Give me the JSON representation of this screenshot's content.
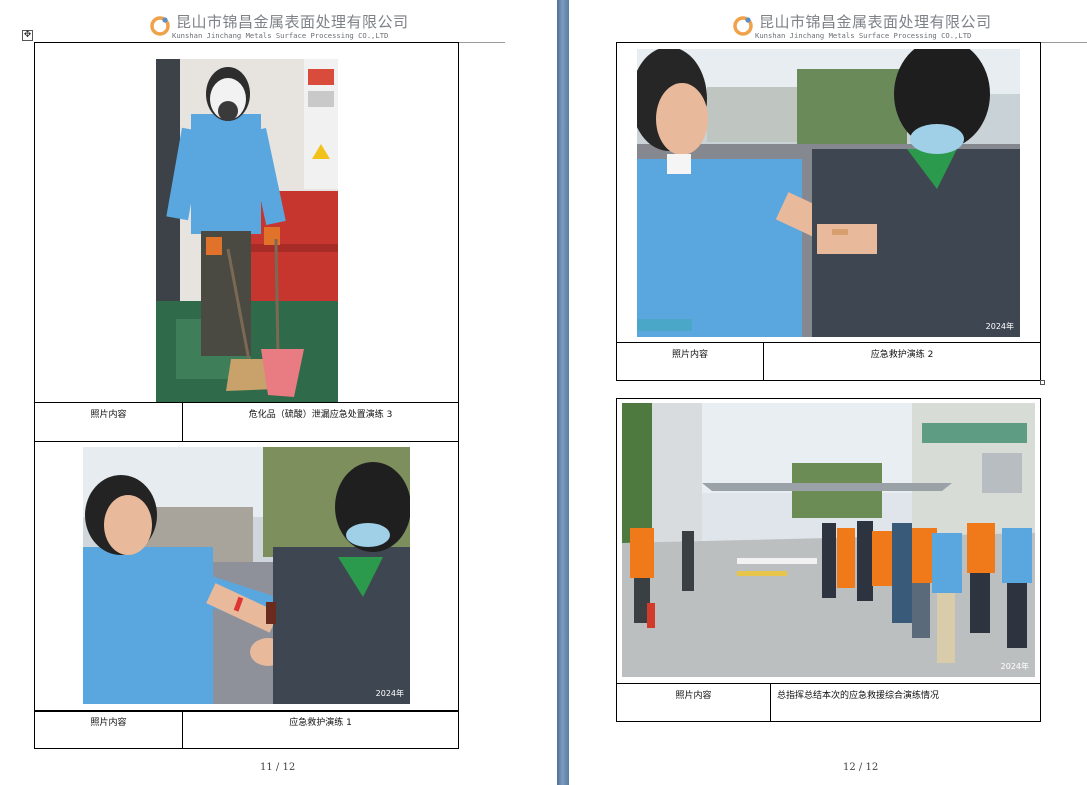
{
  "header": {
    "company_cn": "昆山市锦昌金属表面处理有限公司",
    "company_en": "Kunshan Jinchang Metals Surface Processing CO.,LTD"
  },
  "left_page": {
    "page_number": "11 / 12",
    "photo1": {
      "label": "照片内容",
      "caption": "危化品（硫酸）泄漏应急处置演练 3"
    },
    "photo2": {
      "label": "照片内容",
      "caption": "应急救护演练 1",
      "stamp": "2024年"
    }
  },
  "right_page": {
    "page_number": "12 / 12",
    "photo1": {
      "label": "照片内容",
      "caption": "应急救护演练 2",
      "stamp": "2024年"
    },
    "photo2": {
      "label": "照片内容",
      "caption": "总指挥总结本次的应急救援综合演练情况",
      "stamp": "2024年"
    }
  },
  "icons": {
    "table_move": "move-handle-icon"
  },
  "colors": {
    "gutter": "#5a7da3",
    "logo_orange": "#f0a24a",
    "uniform_blue": "#5aa7e0",
    "safety_orange": "#f07a1a"
  }
}
